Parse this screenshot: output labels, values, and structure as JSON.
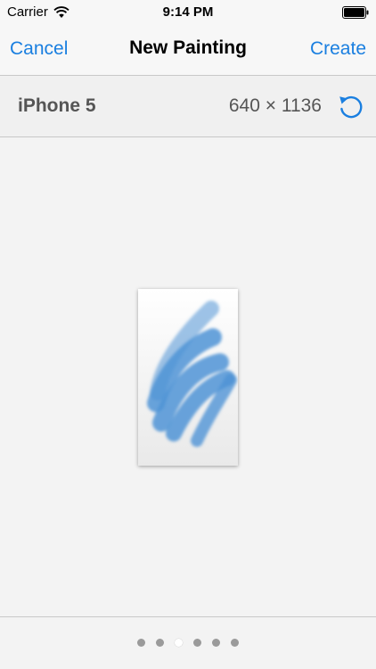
{
  "status_bar": {
    "carrier": "Carrier",
    "time": "9:14 PM"
  },
  "nav": {
    "cancel_label": "Cancel",
    "title": "New Painting",
    "create_label": "Create"
  },
  "device": {
    "name": "iPhone 5",
    "size": "640 × 1136"
  },
  "page_control": {
    "count": 6,
    "current": 3
  },
  "colors": {
    "accent": "#1a7fe0",
    "stroke": "#4f94d6"
  },
  "icons": {
    "rotate": "rotate-icon",
    "wifi": "wifi-icon",
    "battery": "battery-icon"
  }
}
